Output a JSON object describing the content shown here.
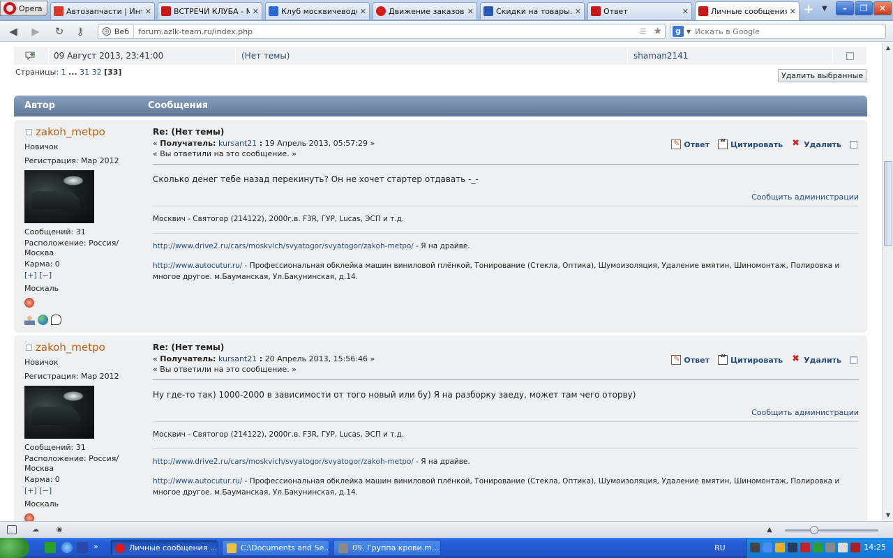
{
  "browser": {
    "opera_label": "Opera",
    "tabs": [
      {
        "label": "Автозапчасти | Инт...",
        "fav_color": "#d83a2a"
      },
      {
        "label": "ВСТРЕЧИ КЛУБА - М...",
        "fav_color": "#c81818"
      },
      {
        "label": "Клуб москвичеводо...",
        "fav_color": "#2a6ad8"
      },
      {
        "label": "Движение заказов",
        "fav_color": "#d81c1c"
      },
      {
        "label": "Скидки на товары....",
        "fav_color": "#2a58b8"
      },
      {
        "label": "Ответ",
        "fav_color": "#c81818"
      },
      {
        "label": "Личные сообщения",
        "fav_color": "#c81818"
      }
    ],
    "close_glyph": "✕",
    "newtab_glyph": "+",
    "address": {
      "scheme_label": "Веб",
      "url": "forum.azlk-team.ru/index.php"
    },
    "search": {
      "engine_letter": "g",
      "placeholder": "Искать в Google"
    }
  },
  "pm_row": {
    "date": "09 Август 2013, 23:41:00",
    "subject": "(Нет темы)",
    "from": "shaman2141"
  },
  "pagination": {
    "label": "Страницы:",
    "first": "1",
    "ellipsis": "...",
    "p31": "31",
    "p32": "32",
    "current": "[33]"
  },
  "delete_selected_label": "Удалить выбранные",
  "header": {
    "author": "Автор",
    "messages": "Сообщения"
  },
  "actions": {
    "reply": "Ответ",
    "quote": "Цитировать",
    "delete": "Удалить"
  },
  "posts": [
    {
      "author": "zakoh_metpo",
      "rank": "Новичок",
      "registration": "Регистрация: Мар 2012",
      "messages": "Сообщений: 31",
      "location": "Расположение: Россия/ Москва",
      "karma": "Карма: 0",
      "karma_plus": "[+]",
      "karma_minus": "[−]",
      "custom_title": "Москаль",
      "title": "Re: (Нет темы)",
      "recipient_label": "Получатель:",
      "recipient": "kursant21",
      "date": "19 Апрель 2013, 05:57:29",
      "replied_note": "« Вы ответили на это сообщение. »",
      "body": "Сколько денег тебе назад перекинуть? Он не хочет стартер отдавать -_-",
      "report": "Сообщить администрации",
      "signature": {
        "line1": "Москвич - Святогор (214122), 2000г.в. F3R, ГУР, Lucas, ЭСП и т.д.",
        "link1": "http://www.drive2.ru/cars/moskvich/svyatogor/svyatogor/zakoh-metpo/",
        "link1_suffix": " - Я на драйве.",
        "link2": "http://www.autocutur.ru/",
        "link2_suffix": " - Профессиональная обклейка машин виниловой плёнкой, Тонирование (Стекла, Оптика), Шумоизоляция, Удаление вмятин, Шиномонтаж, Полировка и многое другое. м.Бауманская, Ул.Бакунинская, д.14."
      }
    },
    {
      "author": "zakoh_metpo",
      "rank": "Новичок",
      "registration": "Регистрация: Мар 2012",
      "messages": "Сообщений: 31",
      "location": "Расположение: Россия/ Москва",
      "karma": "Карма: 0",
      "karma_plus": "[+]",
      "karma_minus": "[−]",
      "custom_title": "Москаль",
      "title": "Re: (Нет темы)",
      "recipient_label": "Получатель:",
      "recipient": "kursant21",
      "date": "20 Апрель 2013, 15:56:46",
      "replied_note": "« Вы ответили на это сообщение. »",
      "body": "Ну где-то так) 1000-2000 в зависимости от того новый или бу) Я на разборку заеду, может там чего оторву)",
      "report": "Сообщить администрации",
      "signature": {
        "line1": "Москвич - Святогор (214122), 2000г.в. F3R, ГУР, Lucas, ЭСП и т.д.",
        "link1": "http://www.drive2.ru/cars/moskvich/svyatogor/svyatogor/zakoh-metpo/",
        "link1_suffix": " - Я на драйве.",
        "link2": "http://www.autocutur.ru/",
        "link2_suffix": " - Профессиональная обклейка машин виниловой плёнкой, Тонирование (Стекла, Оптика), Шумоизоляция, Удаление вмятин, Шиномонтаж, Полировка и многое другое. м.Бауманская, Ул.Бакунинская, д.14."
      }
    }
  ],
  "taskbar": {
    "items": [
      {
        "label": "Личные сообщения ...",
        "icon_color": "#d81c1c"
      },
      {
        "label": "C:\\Documents and Se...",
        "icon_color": "#e8c04a"
      },
      {
        "label": "09. Группа крови.m...",
        "icon_color": "#888888"
      }
    ],
    "language": "RU",
    "clock": "14:25"
  }
}
